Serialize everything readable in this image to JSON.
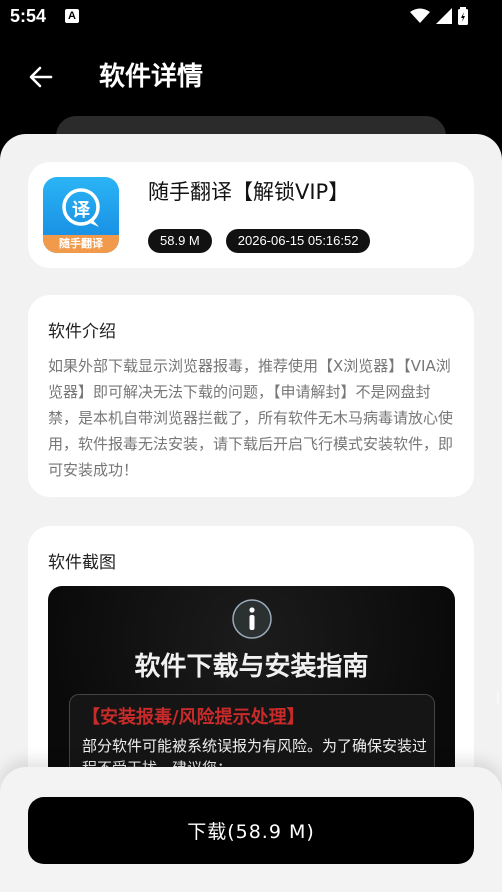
{
  "status_bar": {
    "time": "5:54",
    "notif_icon": "A"
  },
  "header": {
    "title": "软件详情"
  },
  "app": {
    "name": "随手翻译【解锁VIP】",
    "size": "58.9 M",
    "date": "2026-06-15 05:16:52",
    "icon_glyph": "译",
    "icon_caption": "随手翻译",
    "icon_color": "#1aa3f0"
  },
  "intro": {
    "title": "软件介绍",
    "text": "如果外部下载显示浏览器报毒，推荐使用【X浏览器】【VIA浏览器】即可解决无法下载的问题，【申请解封】不是网盘封禁，是本机自带浏览器拦截了，所有软件无木马病毒请放心使用，软件报毒无法安装，请下载后开启飞行模式安装软件，即可安装成功！"
  },
  "screenshots": {
    "title": "软件截图",
    "shot_title": "软件下载与安装指南",
    "warn": "【安装报毒/风险提示处理】",
    "body": "部分软件可能被系统误报为有风险。为了确保安装过程不受干扰，建议您："
  },
  "download": {
    "label": "下载(58.9 M)"
  }
}
